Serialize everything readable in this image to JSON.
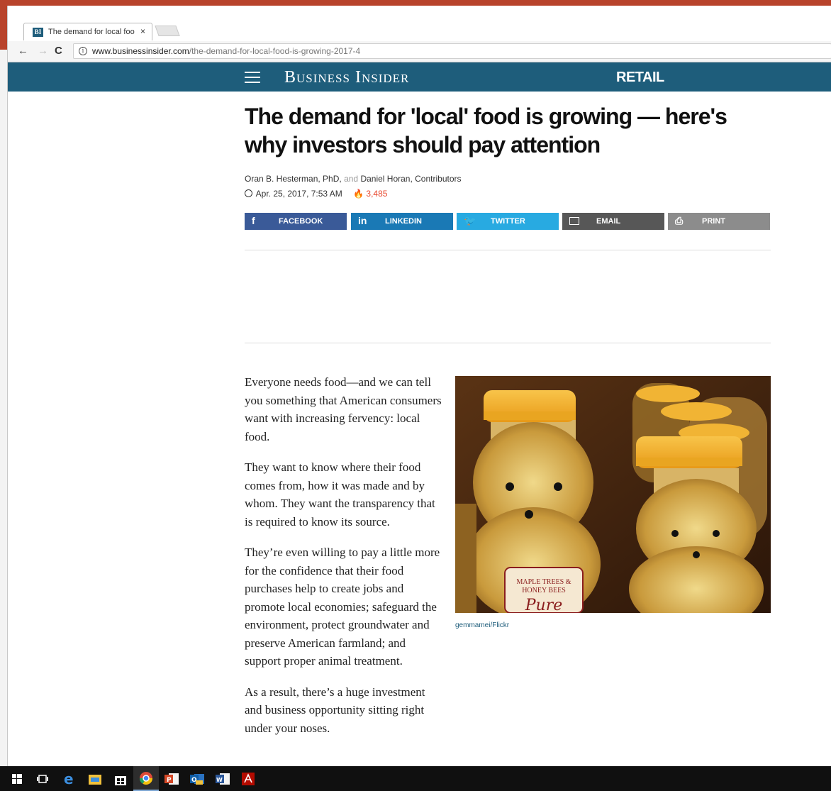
{
  "browser": {
    "tab_title": "The demand for local foo",
    "tab_close": "×",
    "url_host": "www.businessinsider.com",
    "url_path": "/the-demand-for-local-food-is-growing-2017-4",
    "nav": {
      "back": "←",
      "forward": "→",
      "reload": "C"
    },
    "favicon_text": "BI"
  },
  "site": {
    "brand": "Business Insider",
    "section": "RETAIL"
  },
  "article": {
    "headline": "The demand for 'local' food is growing — here's why investors should pay attention",
    "author1": "Oran B. Hesterman, PhD,",
    "and_text": "and",
    "author2": "Daniel Horan, Contributors",
    "date": "Apr. 25, 2017, 7:53 AM",
    "views": "3,485",
    "share": {
      "facebook": "FACEBOOK",
      "linkedin": "LINKEDIN",
      "twitter": "TWITTER",
      "email": "EMAIL",
      "print": "PRINT"
    },
    "paragraphs": [
      "Everyone needs food—and we can tell you something that American consumers want with increasing fervency: local food.",
      "They want to know where their food comes from, how it was made and by whom. They want the transparency that is required to know its source.",
      "They’re even willing to pay a little more for the confidence that their food purchases help to create jobs and promote local economies; safeguard the environment, protect groundwater and preserve American farmland; and support proper animal treatment.",
      "As a result, there’s a huge investment and business opportunity sitting right under your noses."
    ],
    "image_caption": "gemmamei/Flickr",
    "label_line1": "MAPLE TREES &",
    "label_line2": "HONEY BEES",
    "label_script": "Pure"
  },
  "colors": {
    "brand_blue": "#1e5d7b",
    "facebook": "#3a5a98",
    "linkedin": "#1a79b5",
    "twitter": "#28aae1",
    "email": "#575757",
    "print": "#8c8c8c",
    "accent_red": "#e8492f"
  },
  "taskbar": {
    "icons": [
      "windows-start-icon",
      "task-view-icon",
      "edge-icon",
      "file-explorer-icon",
      "store-icon",
      "chrome-icon",
      "powerpoint-icon",
      "outlook-icon",
      "word-icon",
      "acrobat-icon"
    ]
  }
}
